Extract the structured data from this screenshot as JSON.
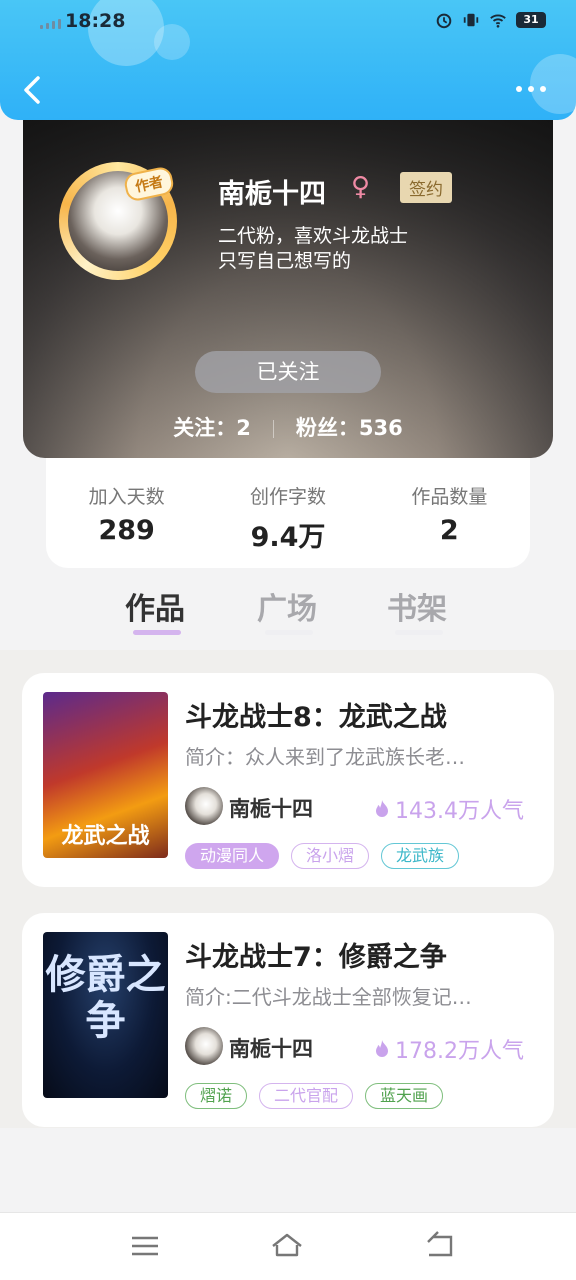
{
  "status_bar": {
    "time": "18:28",
    "battery": "31"
  },
  "profile": {
    "avatar_badge": "作者",
    "name": "南栀十四",
    "gender_symbol": "♀",
    "signed_badge": "签约",
    "bio_line1": "二代粉，喜欢斗龙战士",
    "bio_line2": "只写自己想写的",
    "follow_button": "已关注",
    "following_label": "关注：",
    "following_count": "2",
    "fans_label": "粉丝：",
    "fans_count": "536"
  },
  "stats": [
    {
      "label": "加入天数",
      "value": "289"
    },
    {
      "label": "创作字数",
      "value": "9.4万"
    },
    {
      "label": "作品数量",
      "value": "2"
    }
  ],
  "tabs": [
    {
      "label": "作品",
      "active": true
    },
    {
      "label": "广场",
      "active": false
    },
    {
      "label": "书架",
      "active": false
    }
  ],
  "books": [
    {
      "cover_text": "龙武之战",
      "title": "斗龙战士8：龙武之战",
      "intro": "简介：众人来到了龙武族长老…",
      "author": "南栀十四",
      "popularity": "143.4万人气",
      "tags": [
        "动漫同人",
        "洛小熠",
        "龙武族"
      ]
    },
    {
      "cover_text": "修爵之争",
      "title": "斗龙战士7：修爵之争",
      "intro": "简介:二代斗龙战士全部恢复记…",
      "author": "南栀十四",
      "popularity": "178.2万人气",
      "tags": [
        "熠诺",
        "二代官配",
        "蓝天画"
      ]
    }
  ],
  "colors": {
    "header_blue": "#2fb1f7",
    "accent_purple": "#c9a3ec",
    "tag_teal": "#3bb7c9",
    "tag_green": "#51a24e"
  }
}
